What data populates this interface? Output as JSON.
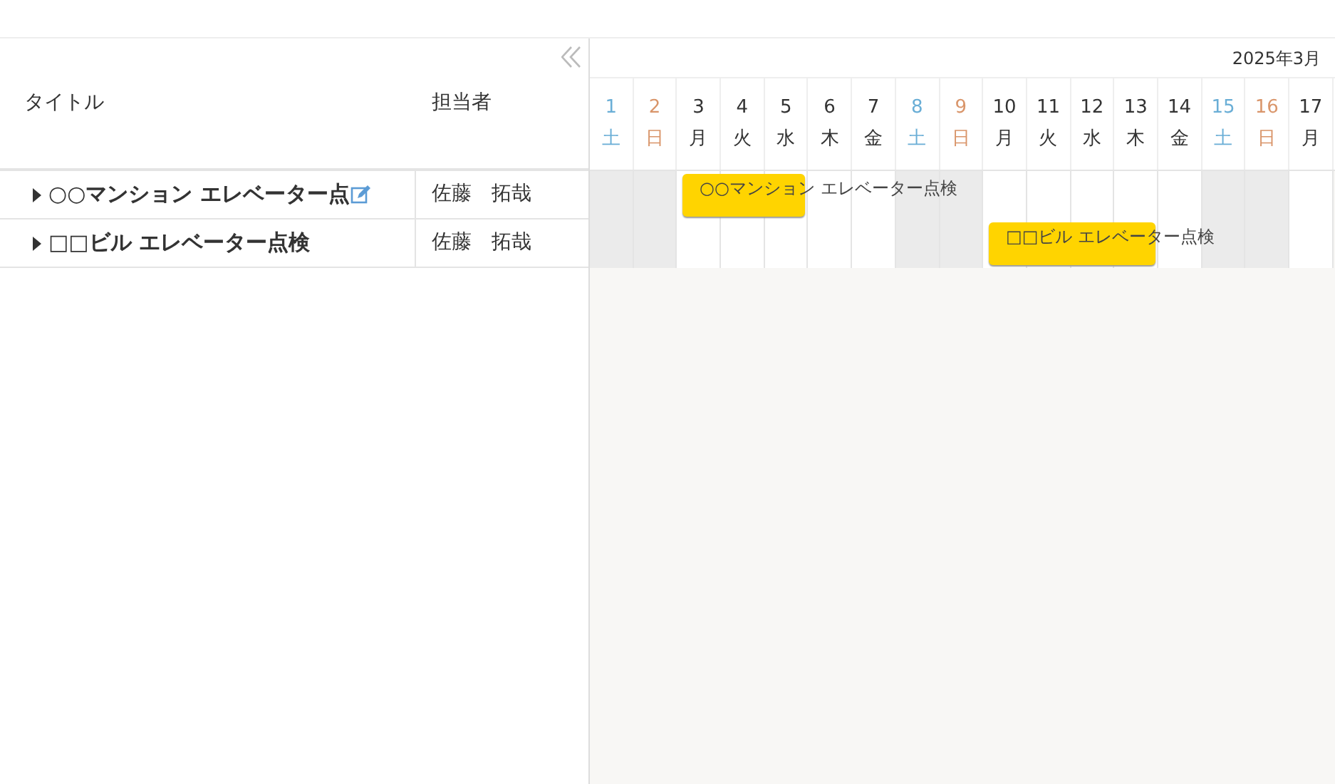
{
  "grid": {
    "columns": [
      {
        "label": "タイトル"
      },
      {
        "label": "担当者"
      }
    ],
    "rows": [
      {
        "title": "○○マンション エレベーター点",
        "assignee": "佐藤　拓哉",
        "expanded": false,
        "editing": true
      },
      {
        "title": "□□ビル エレベーター点検",
        "assignee": "佐藤　拓哉",
        "expanded": false,
        "editing": false
      }
    ]
  },
  "timeline": {
    "month": "2025年3月",
    "days": [
      {
        "date": "1",
        "weekday": "土",
        "kind": "sat"
      },
      {
        "date": "2",
        "weekday": "日",
        "kind": "sun"
      },
      {
        "date": "3",
        "weekday": "月",
        "kind": "weekday"
      },
      {
        "date": "4",
        "weekday": "火",
        "kind": "weekday"
      },
      {
        "date": "5",
        "weekday": "水",
        "kind": "weekday"
      },
      {
        "date": "6",
        "weekday": "木",
        "kind": "weekday"
      },
      {
        "date": "7",
        "weekday": "金",
        "kind": "weekday"
      },
      {
        "date": "8",
        "weekday": "土",
        "kind": "sat"
      },
      {
        "date": "9",
        "weekday": "日",
        "kind": "sun"
      },
      {
        "date": "10",
        "weekday": "月",
        "kind": "weekday"
      },
      {
        "date": "11",
        "weekday": "火",
        "kind": "weekday"
      },
      {
        "date": "12",
        "weekday": "水",
        "kind": "weekday"
      },
      {
        "date": "13",
        "weekday": "木",
        "kind": "weekday"
      },
      {
        "date": "14",
        "weekday": "金",
        "kind": "weekday"
      },
      {
        "date": "15",
        "weekday": "土",
        "kind": "sat"
      },
      {
        "date": "16",
        "weekday": "日",
        "kind": "sun"
      },
      {
        "date": "17",
        "weekday": "月",
        "kind": "weekday"
      }
    ],
    "bars": [
      {
        "label": "○○マンション エレベーター点検"
      },
      {
        "label": "□□ビル エレベーター点検"
      }
    ]
  }
}
